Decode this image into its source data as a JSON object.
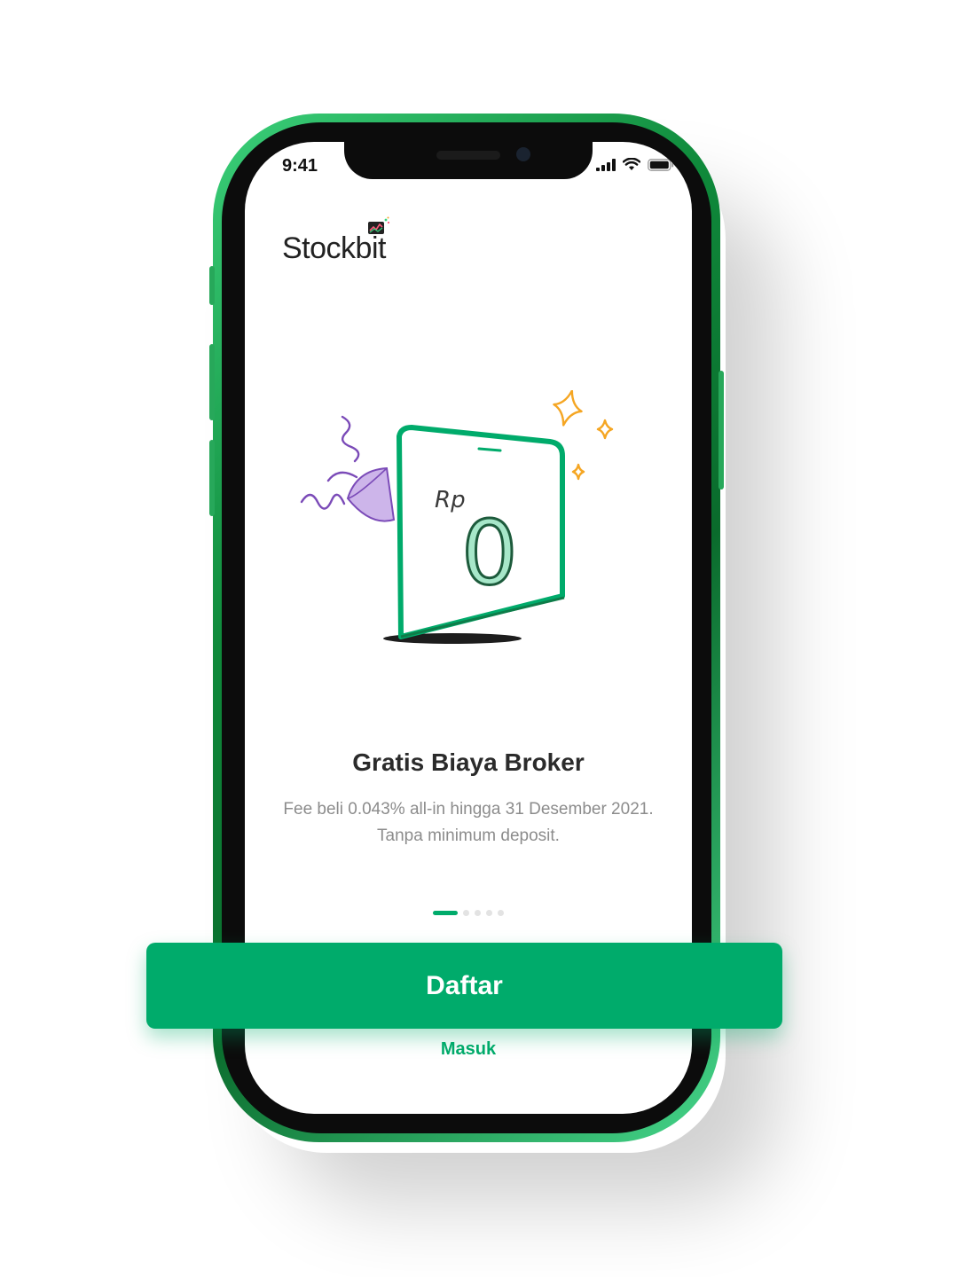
{
  "status_bar": {
    "time": "9:41"
  },
  "brand": {
    "name": "Stockbit",
    "color": "#00ab6b"
  },
  "onboarding": {
    "illustration": {
      "currency_label": "Rp",
      "amount": "0"
    },
    "title": "Gratis Biaya Broker",
    "description": "Fee beli 0.043% all-in hingga 31 Desember 2021. Tanpa minimum deposit.",
    "pager": {
      "total_pages": 5,
      "current_page": 1
    }
  },
  "actions": {
    "register_label": "Daftar",
    "login_label": "Masuk"
  },
  "icons": {
    "signal": "cellular-signal-icon",
    "wifi": "wifi-icon",
    "battery": "battery-icon",
    "logo_mark": "stockbit-logo-icon",
    "party_popper": "party-popper-icon",
    "sparkles": "sparkle-icon"
  },
  "colors": {
    "accent_green": "#00ab6b",
    "illustration_purple": "#8a4fc3",
    "sparkle_yellow": "#f5a623",
    "text_dark": "#2b2b2b",
    "text_muted": "#8c8c8c"
  }
}
